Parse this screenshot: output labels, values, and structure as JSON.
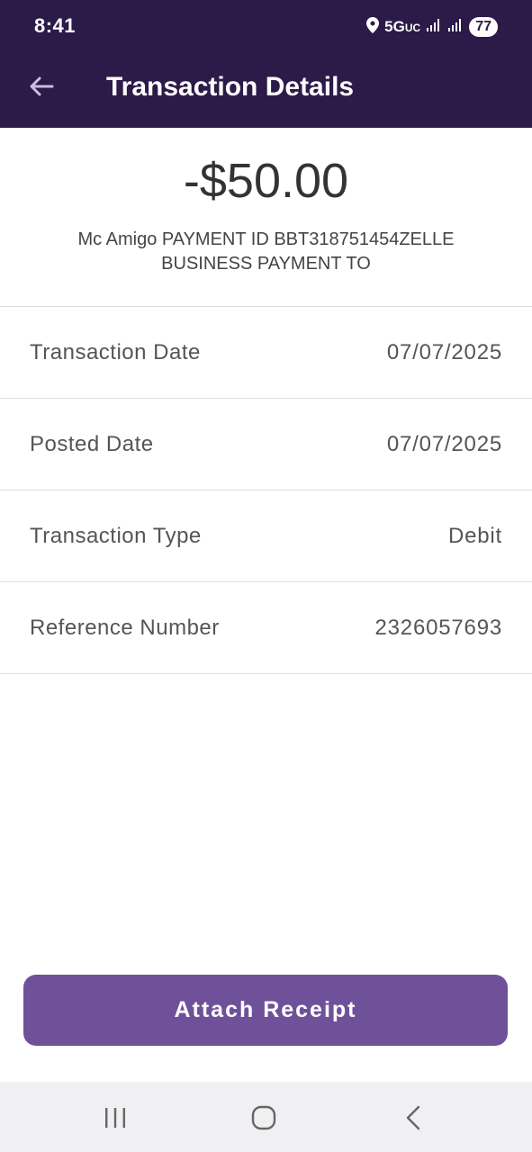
{
  "status_bar": {
    "time": "8:41",
    "network": "5G",
    "network_suffix": "UC",
    "battery": "77",
    "icons": [
      "location-icon",
      "signal-icon",
      "signal-icon"
    ]
  },
  "app_bar": {
    "title": "Transaction Details",
    "back_icon": "arrow-left-icon"
  },
  "transaction": {
    "amount": "-$50.00",
    "description": "Mc Amigo PAYMENT ID BBT318751454ZELLE BUSINESS PAYMENT TO"
  },
  "details": [
    {
      "label": "Transaction Date",
      "value": "07/07/2025"
    },
    {
      "label": "Posted Date",
      "value": "07/07/2025"
    },
    {
      "label": "Transaction Type",
      "value": "Debit"
    },
    {
      "label": "Reference Number",
      "value": "2326057693"
    }
  ],
  "actions": {
    "attach_receipt": "Attach Receipt"
  },
  "nav": {
    "icons": [
      "recent-apps-icon",
      "home-icon",
      "back-icon"
    ]
  },
  "colors": {
    "header": "#2c1a49",
    "button": "#6f519a",
    "text": "#555555"
  }
}
